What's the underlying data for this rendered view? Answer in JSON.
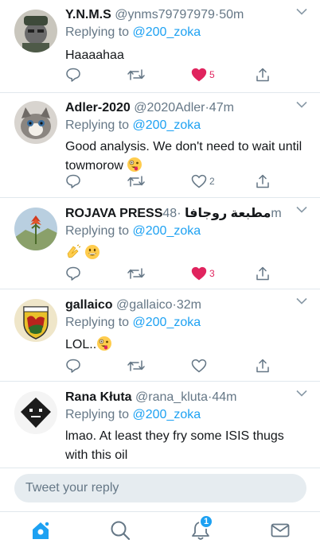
{
  "replies": [
    {
      "name": "Y.N.M.S",
      "handle": "@ynms79797979",
      "time": "50m",
      "reply_prefix": "Replying to",
      "reply_to": "@200_zoka",
      "text": "Haaaahaa",
      "likes": "5",
      "liked": true,
      "emoji": []
    },
    {
      "name": "Adler-2020",
      "handle": "@2020Adler",
      "time": "47m",
      "reply_prefix": "Replying to",
      "reply_to": "@200_zoka",
      "text": "Good analysis. We don't need to wait until towmorow",
      "likes": "2",
      "liked": false,
      "emoji": [
        "zany-face"
      ]
    },
    {
      "name": "ROJAVA PRESSمطبعة روجافا",
      "handle": "",
      "time": "48m",
      "reply_prefix": "Replying to",
      "reply_to": "@200_zoka",
      "text": "",
      "likes": "3",
      "liked": true,
      "emoji": [
        "clapping-hands",
        "grinning-face"
      ]
    },
    {
      "name": "gallaico",
      "handle": "@gallaico",
      "time": "32m",
      "reply_prefix": "Replying to",
      "reply_to": "@200_zoka",
      "text": "LOL..",
      "likes": "",
      "liked": false,
      "emoji": [
        "zany-face"
      ]
    },
    {
      "name": "Rana Kłuta",
      "handle": "@rana_kluta",
      "time": "44m",
      "reply_prefix": "Replying to",
      "reply_to": "@200_zoka",
      "text": "lmao. At least they fry some ISIS thugs with this oil",
      "likes": "",
      "liked": false,
      "emoji": []
    }
  ],
  "time_separator": "·",
  "compose": {
    "placeholder": "Tweet your reply"
  },
  "tabbar": {
    "notifications_badge": "1",
    "active": "home"
  },
  "colors": {
    "accent": "#1da1f2",
    "like": "#e0245e",
    "secondary": "#657786"
  },
  "icons": [
    "reply-icon",
    "retweet-icon",
    "like-icon",
    "share-icon",
    "chevron-down-icon",
    "home-icon",
    "search-icon",
    "bell-icon",
    "mail-icon"
  ]
}
